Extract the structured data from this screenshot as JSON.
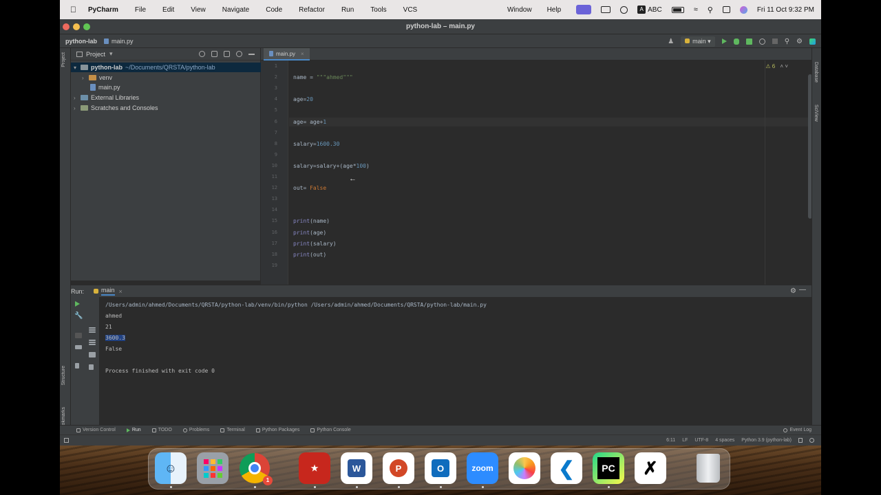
{
  "menubar": {
    "app_name": "PyCharm",
    "menus": [
      "File",
      "Edit",
      "View",
      "Navigate",
      "Code",
      "Refactor",
      "Run",
      "Tools",
      "VCS"
    ],
    "right_menus": [
      "Window",
      "Help"
    ],
    "input_source": "ABC",
    "datetime": "Fri 11 Oct  9:32 PM"
  },
  "window": {
    "title": "python-lab – main.py"
  },
  "navbar": {
    "project": "python-lab",
    "file": "main.py",
    "run_config": "main"
  },
  "project_panel": {
    "title": "Project",
    "tree": [
      {
        "label": "python-lab",
        "path": "~/Documents/QRSTA/python-lab"
      },
      {
        "label": "venv"
      },
      {
        "label": "main.py"
      },
      {
        "label": "External Libraries"
      },
      {
        "label": "Scratches and Consoles"
      }
    ]
  },
  "editor": {
    "tab": "main.py",
    "inspection_count": "6",
    "line_numbers": [
      "1",
      "2",
      "3",
      "4",
      "5",
      "6",
      "7",
      "8",
      "9",
      "10",
      "11",
      "12",
      "13",
      "14",
      "15",
      "16",
      "17",
      "18",
      "19"
    ],
    "lines": [
      {
        "n": "2",
        "code": "name = \"\"\"ahmed\"\"\""
      },
      {
        "n": "4",
        "code": "age=20"
      },
      {
        "n": "6",
        "code": "age= age+1"
      },
      {
        "n": "8",
        "code": "salary=1600.30"
      },
      {
        "n": "10",
        "code": "salary=salary+(age*100)"
      },
      {
        "n": "12",
        "code": "out= False"
      },
      {
        "n": "15",
        "code": "print(name)"
      },
      {
        "n": "16",
        "code": "print(age)"
      },
      {
        "n": "17",
        "code": "print(salary)"
      },
      {
        "n": "18",
        "code": "print(out)"
      }
    ]
  },
  "run_panel": {
    "label": "Run:",
    "tab": "main",
    "output": [
      "/Users/admin/ahmed/Documents/QRSTA/python-lab/venv/bin/python /Users/admin/ahmed/Documents/QRSTA/python-lab/main.py",
      "ahmed",
      "21",
      "3600.3",
      "False",
      "",
      "Process finished with exit code 0"
    ]
  },
  "tool_windows": [
    "Version Control",
    "Run",
    "TODO",
    "Problems",
    "Terminal",
    "Python Packages",
    "Python Console"
  ],
  "event_log": "Event Log",
  "statusbar": {
    "position": "6:11",
    "line_sep": "LF",
    "encoding": "UTF-8",
    "indent": "4 spaces",
    "interpreter": "Python 3.9 (python-lab)"
  },
  "side_tabs": {
    "left": [
      "Project",
      "Structure",
      "Bookmarks"
    ],
    "right": [
      "Database",
      "SciView"
    ]
  },
  "dock": {
    "apps": [
      "Finder",
      "Launchpad",
      "Chrome",
      "Acrobat",
      "Word",
      "PowerPoint",
      "Outlook",
      "Zoom",
      "Photos",
      "VS Code",
      "PyCharm",
      "CapCut",
      "Trash"
    ],
    "chrome_badge": "1",
    "zoom_label": "zoom",
    "pycharm_label": "PC"
  },
  "colors": {
    "accent": "#4a88c7",
    "editor_bg": "#2b2b2b",
    "panel_bg": "#3c3f41",
    "selection": "#0d293e"
  }
}
